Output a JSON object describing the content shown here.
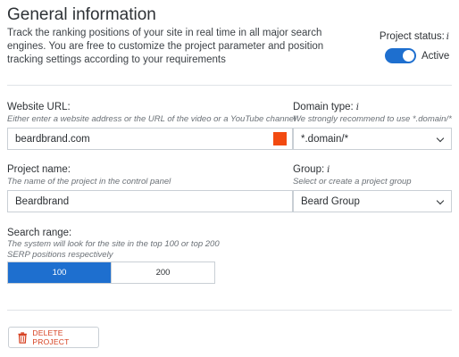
{
  "section": {
    "title": "General information",
    "description": "Track the ranking positions of your site in real time in all major search engines. You are free to customize the project parameter and position tracking settings according to your requirements"
  },
  "status": {
    "label": "Project status:",
    "info": "i",
    "toggle_text": "Active",
    "on": true
  },
  "website": {
    "label": "Website URL:",
    "hint": "Either enter a website address or the URL of the video or a YouTube channel",
    "value": "beardbrand.com",
    "color": "#f24a11"
  },
  "domain_type": {
    "label": "Domain type:",
    "info": "i",
    "hint": "We strongly recommend to use *.domain/*",
    "selected": "*.domain/*"
  },
  "project_name": {
    "label": "Project name:",
    "hint": "The name of the project in the control panel",
    "value": "Beardbrand"
  },
  "group": {
    "label": "Group:",
    "info": "i",
    "hint": "Select or create a project group",
    "selected": "Beard Group"
  },
  "search_range": {
    "label": "Search range:",
    "hint": "The system will look for the site in the top 100 or top 200 SERP positions respectively",
    "options": [
      "100",
      "200"
    ],
    "selected": "100"
  },
  "delete_button": {
    "label": "DELETE PROJECT"
  },
  "colors": {
    "accent": "#1e6fcf",
    "danger": "#d64020"
  }
}
